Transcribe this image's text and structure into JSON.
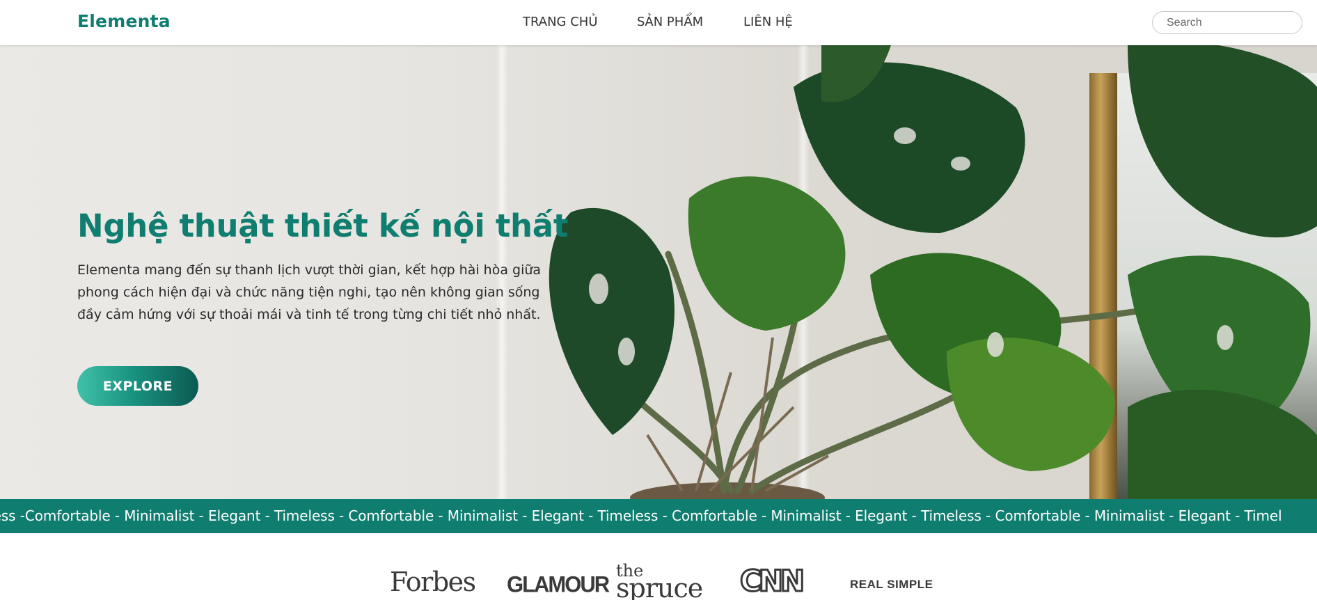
{
  "header": {
    "logo": "Elementa",
    "nav": [
      {
        "label": "TRANG CHỦ"
      },
      {
        "label": "SẢN PHẨM"
      },
      {
        "label": "LIÊN HỆ"
      }
    ],
    "search_placeholder": "Search"
  },
  "hero": {
    "title": "Nghệ thuật thiết kế nội thất",
    "description": "Elementa mang đến sự thanh lịch vượt thời gian, kết hợp hài hòa giữa phong cách hiện đại và chức năng tiện nghi, tạo nên không gian sống đầy cảm hứng với sự thoải mái và tinh tế trong từng chi tiết nhỏ nhất.",
    "button_label": "EXPLORE"
  },
  "strip": {
    "text": "eless -Comfortable - Minimalist - Elegant - Timeless - Comfortable - Minimalist - Elegant - Timeless - Comfortable - Minimalist - Elegant - Timeless - Comfortable - Minimalist - Elegant - Timel"
  },
  "press": {
    "forbes": "Forbes",
    "glamour": "GLAMOUR",
    "spruce_the": "the",
    "spruce": "spruce",
    "cnn": "CNN",
    "realsimple": "REAL SIMPLE"
  },
  "colors": {
    "brand": "#0f7d6f",
    "button_gradient_start": "#3fc1a7",
    "button_gradient_end": "#0b5a50"
  }
}
